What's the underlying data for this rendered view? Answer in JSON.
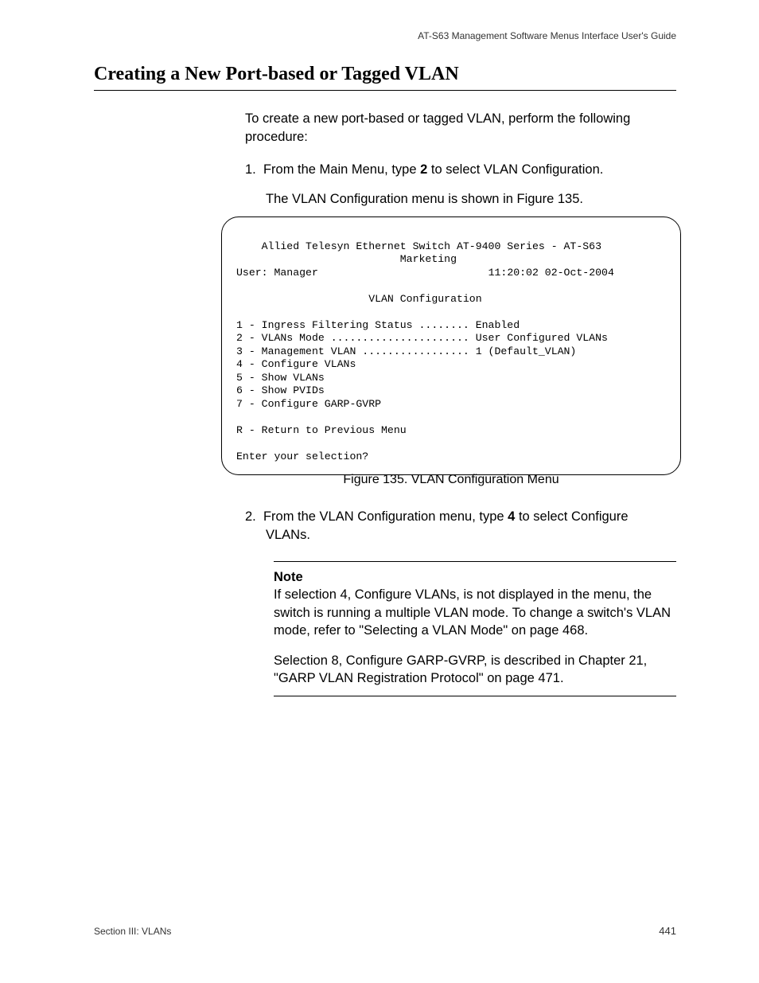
{
  "header": {
    "right": "AT-S63 Management Software Menus Interface User's Guide"
  },
  "title": "Creating a New Port-based or Tagged VLAN",
  "intro": "To create a new port-based or tagged VLAN, perform the following procedure:",
  "step1": {
    "num": "1.",
    "pre": "From the Main Menu, type ",
    "bold": "2",
    "post": " to select VLAN Configuration.",
    "sub": "The VLAN Configuration menu is shown in Figure 135."
  },
  "terminal": {
    "line1": "    Allied Telesyn Ethernet Switch AT-9400 Series - AT-S63",
    "line2": "                          Marketing",
    "line3a": "User: Manager",
    "line3b": "11:20:02 02-Oct-2004",
    "line4": "",
    "line5": "                     VLAN Configuration",
    "line6": "",
    "line7": "1 - Ingress Filtering Status ........ Enabled",
    "line8": "2 - VLANs Mode ...................... User Configured VLANs",
    "line9": "3 - Management VLAN ................. 1 (Default_VLAN)",
    "line10": "4 - Configure VLANs",
    "line11": "5 - Show VLANs",
    "line12": "6 - Show PVIDs",
    "line13": "7 - Configure GARP-GVRP",
    "line14": "",
    "line15": "R - Return to Previous Menu",
    "line16": "",
    "line17": "Enter your selection?"
  },
  "figure_caption": "Figure 135.  VLAN Configuration Menu",
  "step2": {
    "num": "2.",
    "pre": "From the VLAN Configuration menu, type ",
    "bold": "4",
    "post": " to select Configure VLANs."
  },
  "note": {
    "title": "Note",
    "p1": "If selection 4, Configure VLANs, is not displayed in the menu, the switch is running a multiple VLAN mode. To change a switch's VLAN mode, refer to \"Selecting a VLAN Mode\" on page 468.",
    "p2": "Selection 8, Configure GARP-GVRP, is described in Chapter 21, \"GARP VLAN Registration Protocol\" on page 471."
  },
  "footer": {
    "left": "Section III: VLANs",
    "right": "441"
  }
}
